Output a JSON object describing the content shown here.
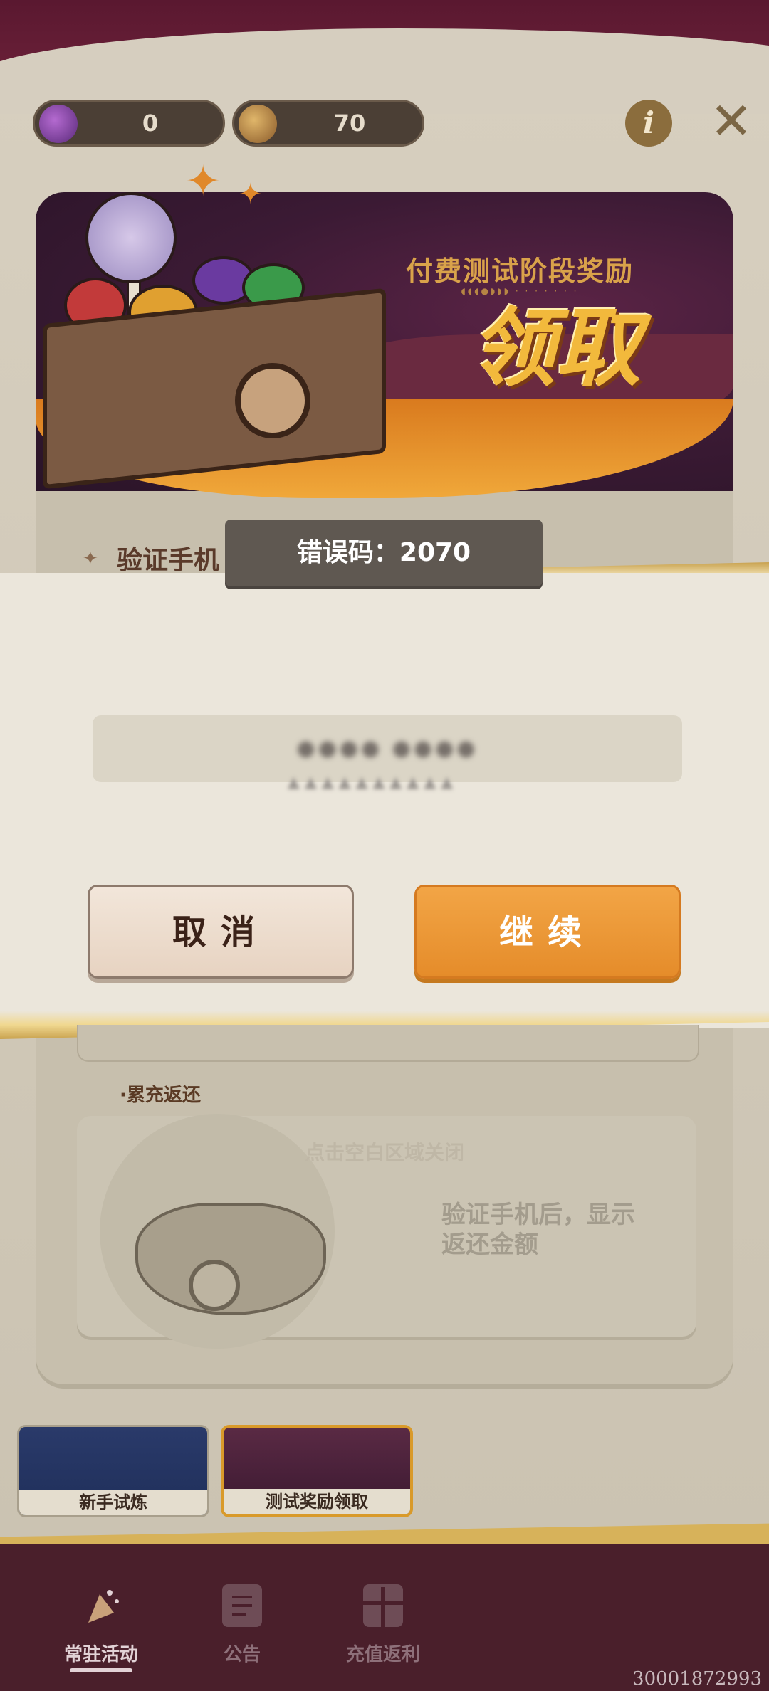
{
  "header": {
    "currencies": [
      {
        "icon": "purple-candy-plus-icon",
        "value": "0"
      },
      {
        "icon": "gold-coin-icon",
        "value": "70"
      }
    ],
    "info_label": "i",
    "close_label": "✕"
  },
  "banner": {
    "subtitle": "付费测试阶段奖励",
    "title": "领取"
  },
  "verify": {
    "label": "验证手机"
  },
  "toast": {
    "text": "错误码：2070"
  },
  "dialog": {
    "cancel_label": "取消",
    "continue_label": "继续"
  },
  "refund": {
    "section_label": "·累充返还",
    "tap_hint": "点击空白区域关闭",
    "message": "验证手机后，显示返还金额"
  },
  "activity_tabs": [
    {
      "label": "新手试炼"
    },
    {
      "label": "测试奖励领取"
    }
  ],
  "bottom_nav": {
    "items": [
      {
        "label": "常驻活动",
        "icon": "party-popper-icon",
        "active": true
      },
      {
        "label": "公告",
        "icon": "document-icon",
        "active": false
      },
      {
        "label": "充值返利",
        "icon": "gift-icon",
        "active": false
      }
    ]
  },
  "build_id": "30001872993",
  "colors": {
    "accent_orange": "#e58c2a",
    "nav_bg": "#4a1f2b",
    "toast_bg": "#5f5851"
  }
}
